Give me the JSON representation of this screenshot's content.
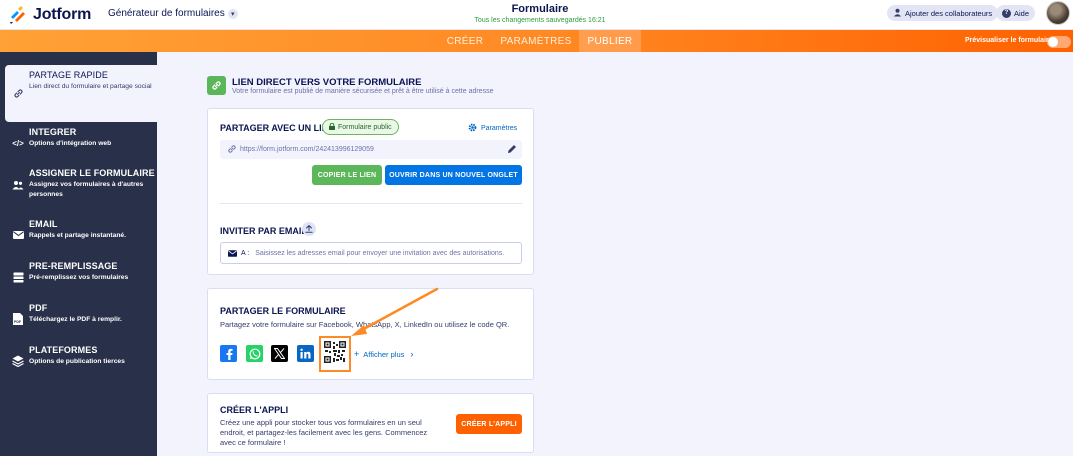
{
  "topbar": {
    "logo": "Jotform",
    "generator": "Générateur de formulaires",
    "form_title": "Formulaire",
    "saved_status": "Tous les changements sauvegardés 16:21",
    "add_collab": "Ajouter des collaborateurs",
    "help": "Aide"
  },
  "navbar": {
    "tabs": [
      {
        "label": "CRÉER"
      },
      {
        "label": "PARAMÈTRES"
      },
      {
        "label": "PUBLIER"
      }
    ],
    "preview_label": "Prévisualiser le formulaire"
  },
  "sidebar": {
    "items": [
      {
        "title": "PARTAGE RAPIDE",
        "desc": "Lien direct du formulaire et partage social"
      },
      {
        "title": "INTEGRER",
        "desc": "Options d'intégration web"
      },
      {
        "title": "ASSIGNER LE FORMULAIRE",
        "desc": "Assignez vos formulaires à d'autres personnes"
      },
      {
        "title": "EMAIL",
        "desc": "Rappels et partage instantané."
      },
      {
        "title": "PRE-REMPLISSAGE",
        "desc": "Pré-remplissez vos formulaires"
      },
      {
        "title": "PDF",
        "desc": "Téléchargez le PDF à remplir."
      },
      {
        "title": "PLATEFORMES",
        "desc": "Options de publication tierces"
      }
    ]
  },
  "main": {
    "header_title": "LIEN DIRECT VERS VOTRE FORMULAIRE",
    "header_desc": "Votre formulaire est publié de manière sécurisée et prêt à être utilisé à cette adresse",
    "share_link": {
      "title": "PARTAGER AVEC UN LIEN",
      "badge": "Formulaire public",
      "params": "Paramètres",
      "url": "https://form.jotform.com/242413996129059",
      "copy_btn": "COPIER LE LIEN",
      "open_btn": "OUVRIR DANS UN NOUVEL ONGLET",
      "invite_title": "INVITER PAR EMAIL",
      "email_prefix": "A :",
      "email_placeholder": "Saisissez les adresses email pour envoyer une invitation avec des autorisations."
    },
    "share_form": {
      "title": "PARTAGER LE FORMULAIRE",
      "desc": "Partagez votre formulaire sur Facebook, WhatsApp, X, LinkedIn ou utilisez le code QR.",
      "more": "Afficher plus"
    },
    "app": {
      "title": "CRÉER L'APPLI",
      "desc": "Créez une appli pour stocker tous vos formulaires en un seul endroit, et partagez-les facilement avec les gens. Commencez avec ce formulaire !",
      "btn": "CRÉER L'APPLI"
    }
  },
  "colors": {
    "accent_orange": "#ff6100",
    "sidebar_bg": "#293049",
    "green": "#5cb75b",
    "blue": "#0075e3"
  }
}
